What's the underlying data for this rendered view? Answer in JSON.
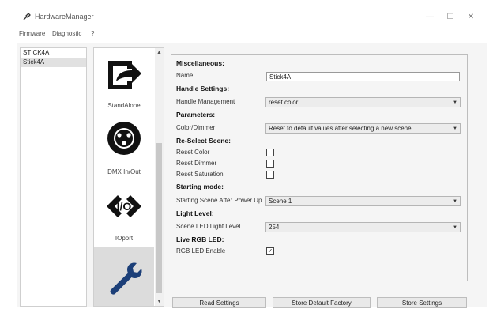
{
  "window": {
    "title": "HardwareManager",
    "controls": {
      "minimize": "—",
      "maximize": "☐",
      "close": "✕"
    }
  },
  "menu": [
    "Firmware",
    "Diagnostic",
    "?"
  ],
  "devices": [
    "STICK4A",
    "Stick4A"
  ],
  "nav": {
    "items": [
      {
        "label": "StandAlone",
        "icon": "arrow-icon"
      },
      {
        "label": "DMX In/Out",
        "icon": "xlr-icon"
      },
      {
        "label": "IOport",
        "icon": "io-icon"
      },
      {
        "label": "",
        "icon": "wrench-icon"
      }
    ]
  },
  "settings": {
    "misc_heading": "Miscellaneous:",
    "name_label": "Name",
    "name_value": "Stick4A",
    "handle_heading": "Handle Settings:",
    "handle_label": "Handle Management",
    "handle_value": "reset color",
    "params_heading": "Parameters:",
    "colordimmer_label": "Color/Dimmer",
    "colordimmer_value": "Reset to default values after selecting a new scene",
    "reselect_heading": "Re-Select Scene:",
    "reset_color_label": "Reset Color",
    "reset_dimmer_label": "Reset Dimmer",
    "reset_saturation_label": "Reset Saturation",
    "starting_heading": "Starting mode:",
    "starting_label": "Starting Scene After Power Up",
    "starting_value": "Scene 1",
    "light_heading": "Light Level:",
    "light_label": "Scene LED Light Level",
    "light_value": "254",
    "live_heading": "Live RGB LED:",
    "rgb_label": "RGB LED Enable",
    "checkbox_states": {
      "reset_color": false,
      "reset_dimmer": false,
      "reset_saturation": false,
      "rgb_enable": true
    }
  },
  "buttons": {
    "read": "Read Settings",
    "store_default": "Store Default Factory",
    "store": "Store Settings"
  }
}
